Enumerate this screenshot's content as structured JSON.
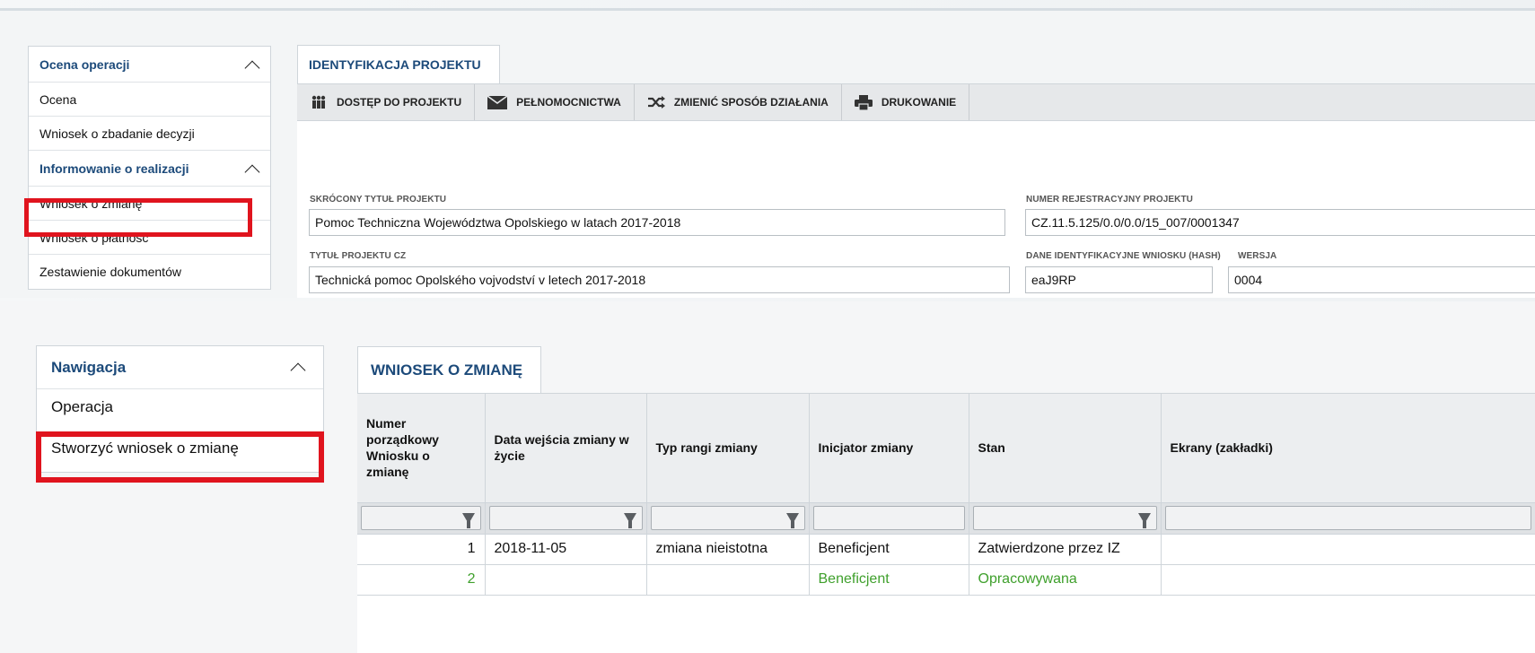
{
  "top_panel": {
    "sidebar": {
      "section1_title": "Ocena operacji",
      "section1_items": [
        "Ocena",
        "Wniosek o zbadanie decyzji"
      ],
      "section2_title": "Informowanie o realizacji",
      "section2_items": [
        "Wniosek o zmianę",
        "Wniosek o płatność",
        "Zestawienie dokumentów"
      ]
    },
    "tab_label": "IDENTYFIKACJA PROJEKTU",
    "toolbar": {
      "access": "DOSTĘP DO PROJEKTU",
      "powers": "PEŁNOMOCNICTWA",
      "change_mode": "ZMIENIĆ SPOSÓB DZIAŁANIA",
      "print": "DRUKOWANIE"
    },
    "form": {
      "short_title_label": "SKRÓCONY TYTUŁ PROJEKTU",
      "short_title_value": "Pomoc Techniczna Województwa Opolskiego w latach 2017-2018",
      "reg_number_label": "NUMER REJESTRACYJNY PROJEKTU",
      "reg_number_value": "CZ.11.5.125/0.0/0.0/15_007/0001347",
      "title_cz_label": "TYTUŁ PROJEKTU CZ",
      "title_cz_value": "Technická pomoc Opolského vojvodství v letech 2017-2018",
      "ident_label": "DANE IDENTYFIKACYJNE WNIOSKU (HASH)",
      "ident_value": "eaJ9RP",
      "version_label": "WERSJA",
      "version_value": "0004"
    }
  },
  "bottom_panel": {
    "sidebar": {
      "title": "Nawigacja",
      "items": [
        "Operacja",
        "Stworzyć wniosek o zmianę"
      ]
    },
    "tab_label": "WNIOSEK O ZMIANĘ",
    "table": {
      "headers": [
        "Numer porządkowy Wniosku o zmianę",
        "Data wejścia zmiany w życie",
        "Typ rangi zmiany",
        "Inicjator zmiany",
        "Stan",
        "Ekrany (zakładki)"
      ],
      "rows": [
        [
          "1",
          "2018-11-05",
          "zmiana nieistotna",
          "Beneficjent",
          "Zatwierdzone przez IZ",
          ""
        ],
        [
          "2",
          "",
          "",
          "Beneficjent",
          "Opracowywana",
          ""
        ]
      ]
    }
  },
  "colors": {
    "accent_blue": "#1c4a7a",
    "highlight_red": "#e0141e",
    "status_green": "#3fa02c"
  }
}
